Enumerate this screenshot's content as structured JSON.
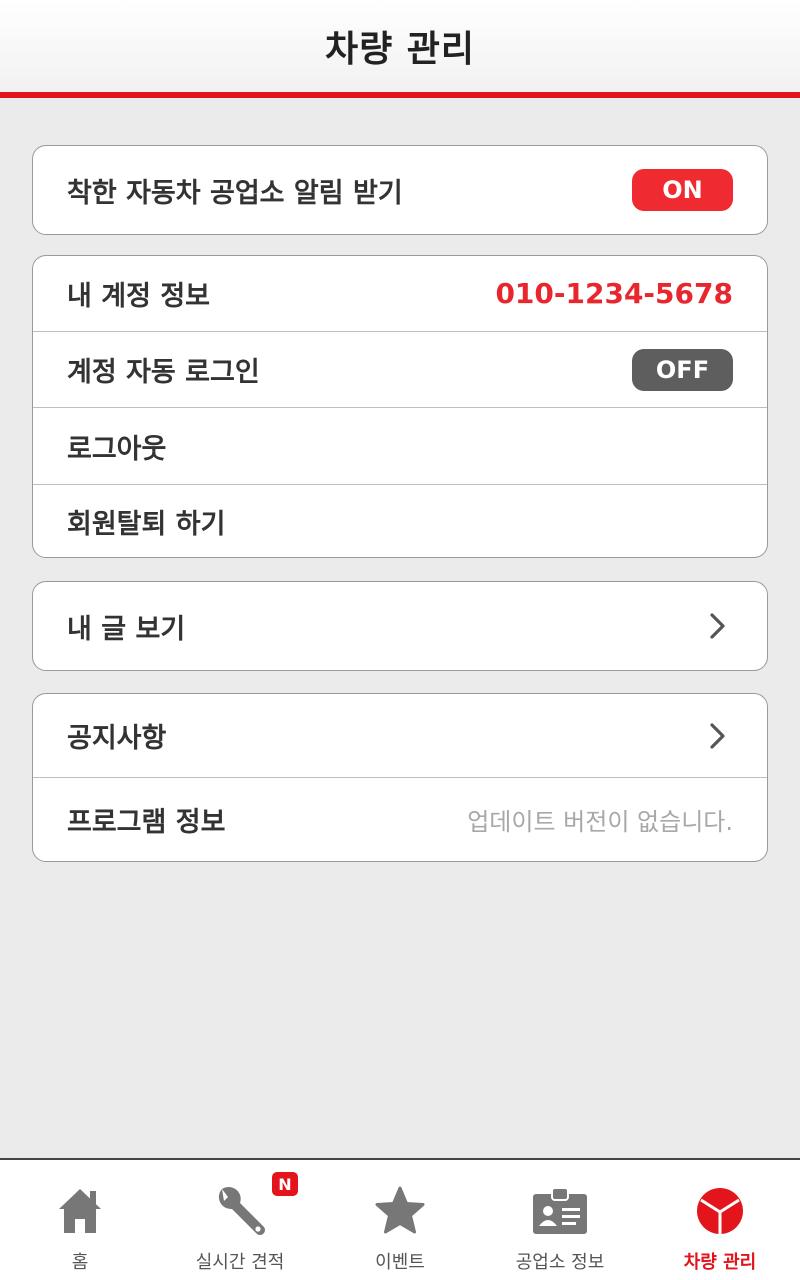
{
  "header": {
    "title": "차량 관리"
  },
  "alerts_card": {
    "label": "착한 자동차 공업소 알림 받기",
    "toggle": "ON"
  },
  "account_card": {
    "account_label": "내 계정 정보",
    "phone": "010-1234-5678",
    "autologin_label": "계정 자동 로그인",
    "autologin_toggle": "OFF",
    "logout_label": "로그아웃",
    "withdraw_label": "회원탈퇴 하기"
  },
  "posts_card": {
    "label": "내 글 보기"
  },
  "info_card": {
    "notice_label": "공지사항",
    "program_label": "프로그램 정보",
    "program_status": "업데이트 버전이 없습니다."
  },
  "tabbar": {
    "items": [
      {
        "label": "홈",
        "icon": "home-icon"
      },
      {
        "label": "실시간 견적",
        "icon": "wrench-icon"
      },
      {
        "label": "이벤트",
        "icon": "star-icon",
        "badge": "N"
      },
      {
        "label": "공업소 정보",
        "icon": "id-card-icon"
      },
      {
        "label": "차량 관리",
        "icon": "car-management-icon",
        "active": true
      }
    ]
  },
  "colors": {
    "accent": "#e3141b",
    "toggle_on": "#ef2a31",
    "toggle_off": "#5e5e5e",
    "background": "#ebebeb"
  }
}
